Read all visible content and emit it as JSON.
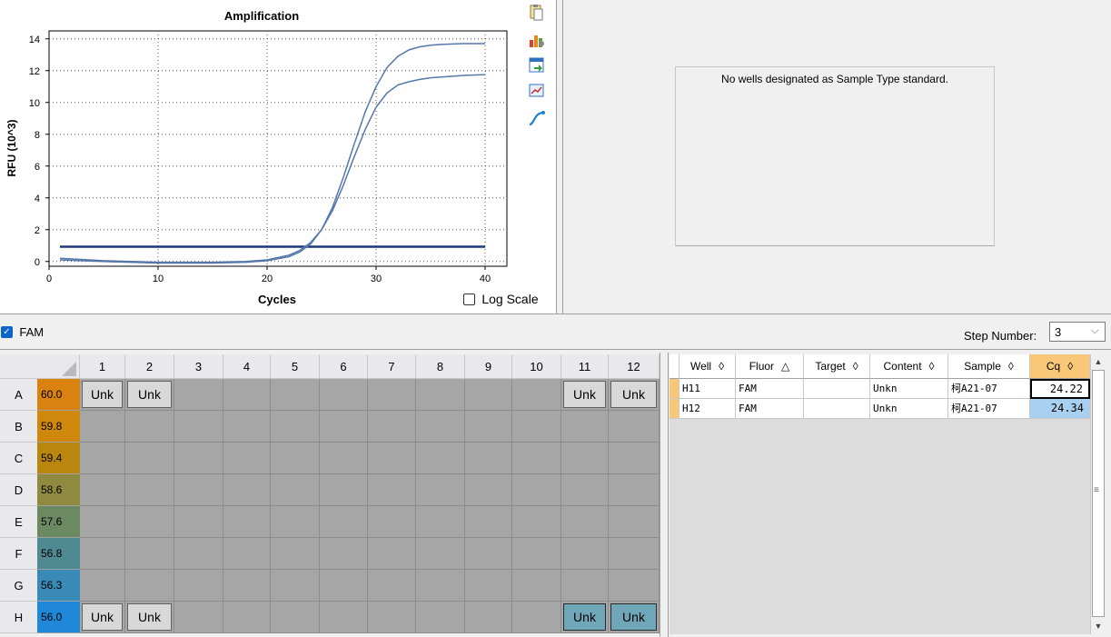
{
  "chart_data": {
    "type": "line",
    "title": "Amplification",
    "xlabel": "Cycles",
    "ylabel": "RFU (10^3)",
    "xlim": [
      0,
      42
    ],
    "ylim": [
      -0.3,
      14.5
    ],
    "xticks": [
      0,
      10,
      20,
      30,
      40
    ],
    "yticks": [
      0,
      2,
      4,
      6,
      8,
      10,
      12,
      14
    ],
    "grid": true,
    "threshold": 0.93,
    "series": [
      {
        "x": [
          1,
          5,
          10,
          15,
          18,
          20,
          22,
          23,
          24,
          25,
          26,
          27,
          28,
          29,
          30,
          31,
          32,
          33,
          34,
          35,
          36,
          38,
          40
        ],
        "y": [
          0.1,
          0.0,
          -0.1,
          -0.1,
          -0.05,
          0.05,
          0.3,
          0.6,
          1.1,
          2.0,
          3.4,
          5.3,
          7.4,
          9.4,
          11.0,
          12.2,
          12.9,
          13.3,
          13.5,
          13.6,
          13.65,
          13.7,
          13.7
        ]
      },
      {
        "x": [
          1,
          5,
          10,
          15,
          18,
          20,
          22,
          23,
          24,
          25,
          26,
          27,
          28,
          29,
          30,
          31,
          32,
          33,
          34,
          35,
          36,
          38,
          40
        ],
        "y": [
          0.2,
          0.05,
          -0.05,
          -0.05,
          0.0,
          0.1,
          0.4,
          0.7,
          1.2,
          2.0,
          3.2,
          4.8,
          6.6,
          8.3,
          9.7,
          10.6,
          11.1,
          11.3,
          11.45,
          11.55,
          11.6,
          11.7,
          11.75
        ]
      }
    ]
  },
  "log_scale": {
    "label": "Log Scale",
    "checked": false
  },
  "std_message": "No wells designated as Sample Type standard.",
  "fluor": {
    "label": "FAM",
    "checked": true
  },
  "step": {
    "label": "Step Number:",
    "value": "3"
  },
  "plate": {
    "columns": [
      "1",
      "2",
      "3",
      "4",
      "5",
      "6",
      "7",
      "8",
      "9",
      "10",
      "11",
      "12"
    ],
    "rows": [
      {
        "label": "A",
        "temp": "60.0",
        "color": "#d9820f",
        "wells": {
          "1": "Unk",
          "2": "Unk",
          "11": "Unk",
          "12": "Unk"
        }
      },
      {
        "label": "B",
        "temp": "59.8",
        "color": "#d0880c",
        "wells": {}
      },
      {
        "label": "C",
        "temp": "59.4",
        "color": "#b9860e",
        "wells": {}
      },
      {
        "label": "D",
        "temp": "58.6",
        "color": "#8f8a40",
        "wells": {}
      },
      {
        "label": "E",
        "temp": "57.6",
        "color": "#6b8a62",
        "wells": {}
      },
      {
        "label": "F",
        "temp": "56.8",
        "color": "#4f8a92",
        "wells": {}
      },
      {
        "label": "G",
        "temp": "56.3",
        "color": "#3a8ab8",
        "wells": {}
      },
      {
        "label": "H",
        "temp": "56.0",
        "color": "#1f88d8",
        "wells": {
          "1": "Unk",
          "2": "Unk",
          "11": "Unk",
          "12": "Unk"
        }
      }
    ],
    "selected": [
      "H11",
      "H12"
    ]
  },
  "table": {
    "headers": [
      {
        "label": "Well",
        "sort": "◊"
      },
      {
        "label": "Fluor",
        "sort": "△"
      },
      {
        "label": "Target",
        "sort": "◊"
      },
      {
        "label": "Content",
        "sort": "◊"
      },
      {
        "label": "Sample",
        "sort": "◊"
      },
      {
        "label": "Cq",
        "sort": "◊"
      }
    ],
    "rows": [
      {
        "well": "H11",
        "fluor": "FAM",
        "target": "",
        "content": "Unkn",
        "sample": "柯A21-07",
        "cq": "24.22"
      },
      {
        "well": "H12",
        "fluor": "FAM",
        "target": "",
        "content": "Unkn",
        "sample": "柯A21-07",
        "cq": "24.34"
      }
    ]
  },
  "colors": {
    "accent": "#0a66c8",
    "cq_header": "#f8c878",
    "row_marker": "#f8c878",
    "selected_cell": "#a8d0f0"
  }
}
